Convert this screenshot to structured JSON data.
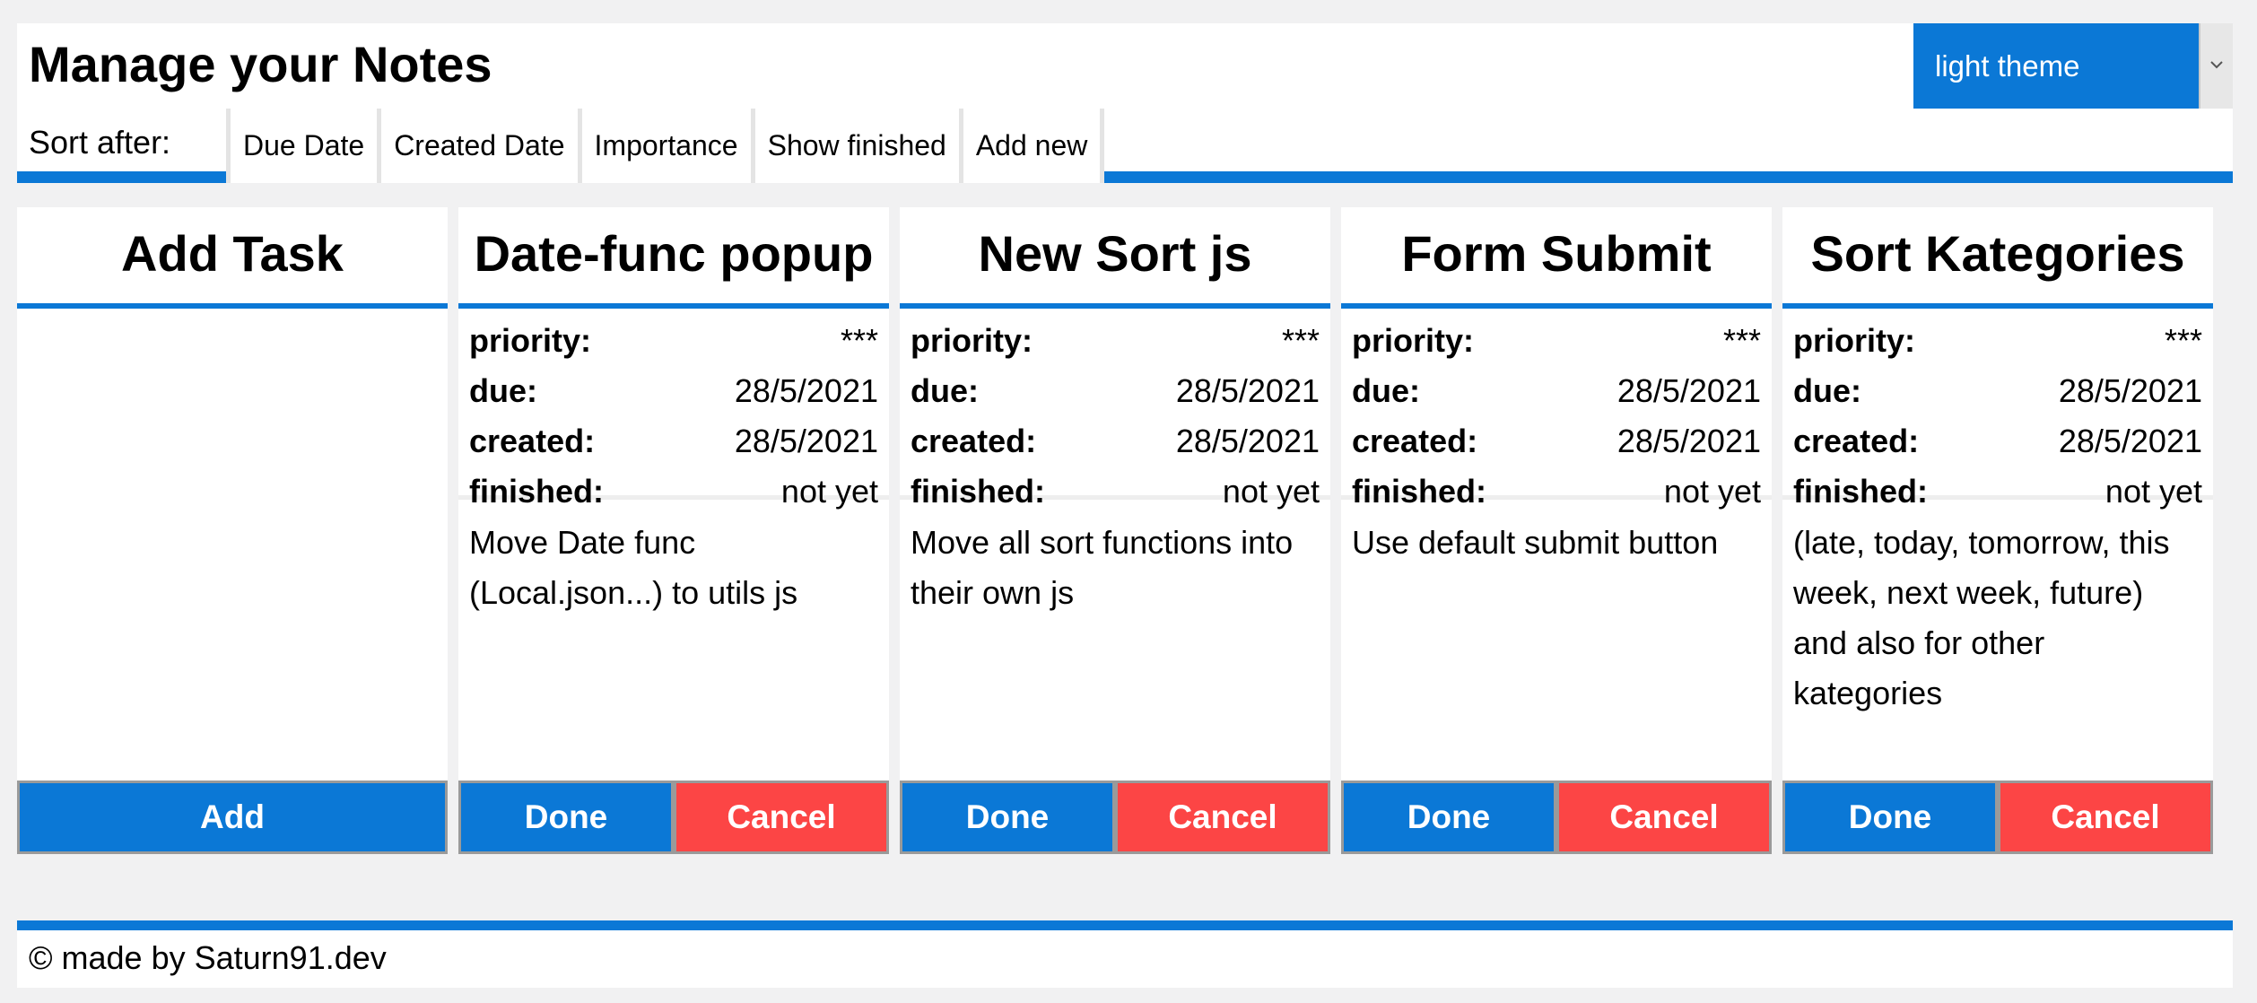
{
  "header": {
    "title": "Manage your Notes",
    "theme_select": {
      "value": "light theme",
      "icon": "chevron-down-icon"
    },
    "sort_label": "Sort after:",
    "sort_buttons": [
      "Due Date",
      "Created Date",
      "Importance",
      "Show finished",
      "Add new"
    ]
  },
  "add_card": {
    "title": "Add Task",
    "button": "Add"
  },
  "labels": {
    "priority": "priority:",
    "due": "due:",
    "created": "created:",
    "finished": "finished:",
    "done": "Done",
    "cancel": "Cancel"
  },
  "notes": [
    {
      "title": "Date-func popup",
      "priority": "***",
      "due": "28/5/2021",
      "created": "28/5/2021",
      "finished": "not yet",
      "description": "Move Date func (Local.json...) to utils js"
    },
    {
      "title": "New Sort js",
      "priority": "***",
      "due": "28/5/2021",
      "created": "28/5/2021",
      "finished": "not yet",
      "description": "Move all sort functions into their own js"
    },
    {
      "title": "Form Submit",
      "priority": "***",
      "due": "28/5/2021",
      "created": "28/5/2021",
      "finished": "not yet",
      "description": "Use default submit button"
    },
    {
      "title": "Sort Kategories",
      "priority": "***",
      "due": "28/5/2021",
      "created": "28/5/2021",
      "finished": "not yet",
      "description": "(late, today, tomorrow, this week, next week, future) and also for other kategories"
    }
  ],
  "colors": {
    "accent": "#0b78d6",
    "danger": "#fc4545",
    "background": "#f1f1f2"
  },
  "footer": {
    "text": "© made by Saturn91.dev"
  }
}
